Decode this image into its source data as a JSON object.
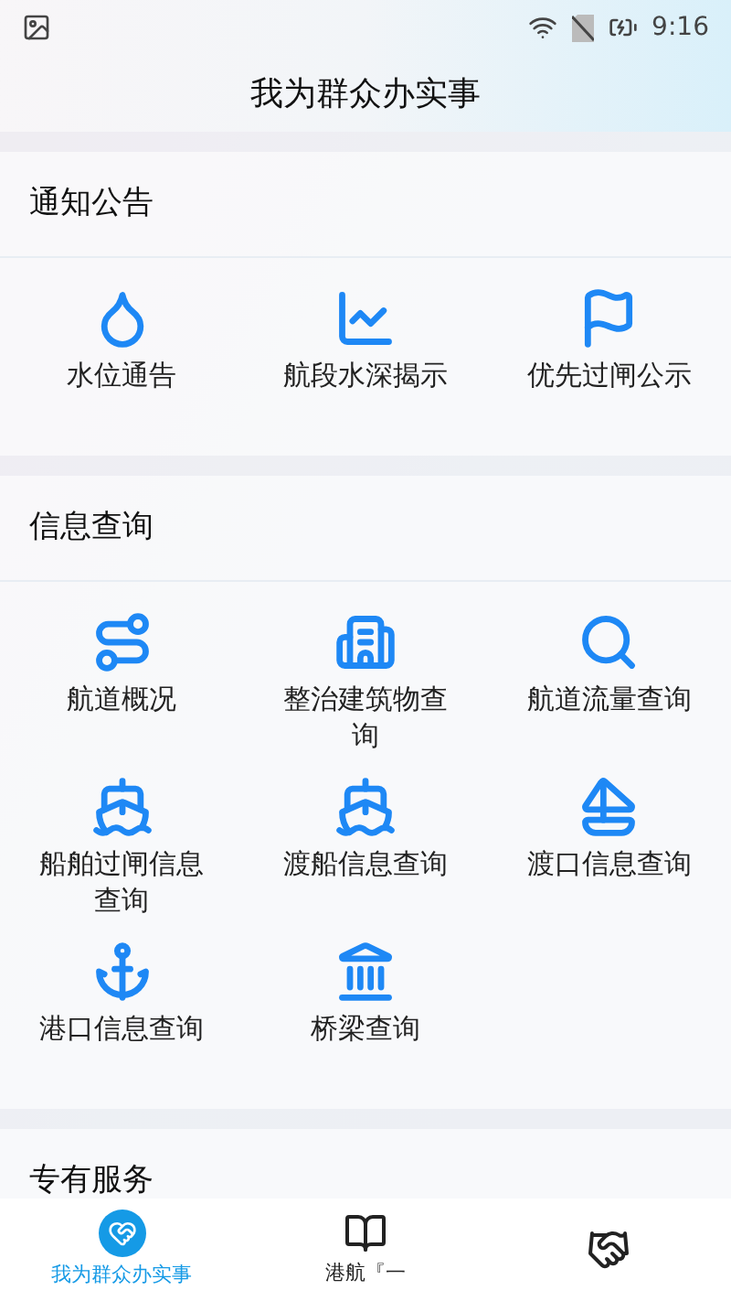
{
  "status_bar": {
    "time": "9:16"
  },
  "header": {
    "title": "我为群众办实事"
  },
  "sections": [
    {
      "title": "通知公告",
      "items": [
        {
          "label": "水位通告"
        },
        {
          "label": "航段水深揭示"
        },
        {
          "label": "优先过闸公示"
        }
      ]
    },
    {
      "title": "信息查询",
      "items": [
        {
          "label": "航道概况"
        },
        {
          "label": "整治建筑物查询"
        },
        {
          "label": "航道流量查询"
        },
        {
          "label": "船舶过闸信息查询"
        },
        {
          "label": "渡船信息查询"
        },
        {
          "label": "渡口信息查询"
        },
        {
          "label": "港口信息查询"
        },
        {
          "label": "桥梁查询"
        }
      ]
    },
    {
      "title": "专有服务"
    }
  ],
  "bottom_nav": [
    {
      "label": "我为群众办实事",
      "selected": true
    },
    {
      "label": "港航『一",
      "selected": false
    },
    {
      "selected": false
    }
  ]
}
